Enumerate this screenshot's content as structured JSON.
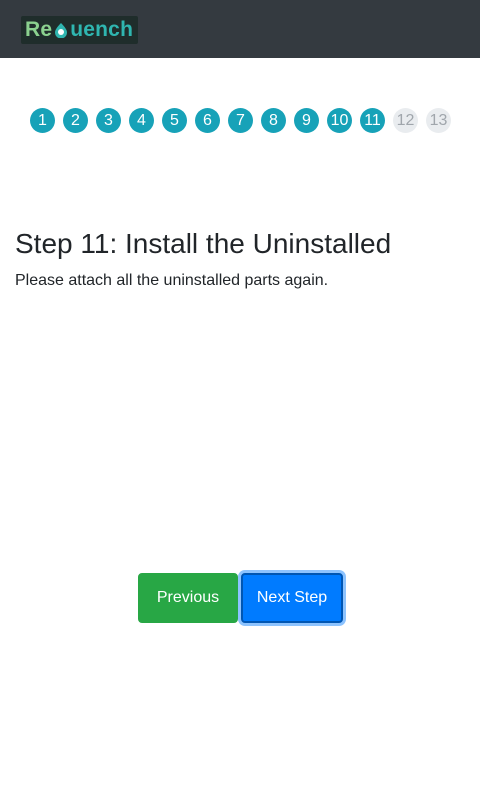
{
  "header": {
    "logo_text_a": "Re",
    "logo_text_b": "uench",
    "logo_icon": "leaf-drop-icon",
    "bg_color": "#343a40"
  },
  "steps": [
    {
      "label": "1",
      "status": "done"
    },
    {
      "label": "2",
      "status": "done"
    },
    {
      "label": "3",
      "status": "done"
    },
    {
      "label": "4",
      "status": "done"
    },
    {
      "label": "5",
      "status": "done"
    },
    {
      "label": "6",
      "status": "done"
    },
    {
      "label": "7",
      "status": "done"
    },
    {
      "label": "8",
      "status": "done"
    },
    {
      "label": "9",
      "status": "done"
    },
    {
      "label": "10",
      "status": "done"
    },
    {
      "label": "11",
      "status": "current"
    },
    {
      "label": "12",
      "status": "todo"
    },
    {
      "label": "13",
      "status": "todo"
    }
  ],
  "main": {
    "title": "Step 11: Install the Uninstalled",
    "description": "Please attach all the uninstalled parts again."
  },
  "nav": {
    "previous_label": "Previous",
    "next_label": "Next Step"
  },
  "colors": {
    "step_done": "#17a2b8",
    "step_todo": "#e9ecef",
    "previous_button": "#28a745",
    "next_button": "#007bff"
  }
}
